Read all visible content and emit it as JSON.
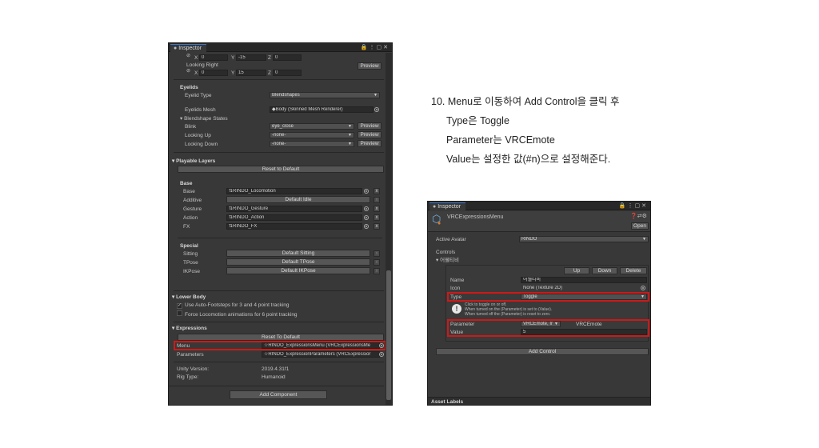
{
  "left_panel": {
    "tab": "Inspector",
    "top": {
      "link_glyph": "⊘",
      "x_label": "X",
      "x1": "0",
      "y_label": "Y",
      "y1": "-15",
      "z_label": "Z",
      "z1": "0",
      "looking_right": "Looking Right",
      "x2": "0",
      "y2": "15",
      "z2": "0",
      "preview": "Preview"
    },
    "eyelids": {
      "header": "Eyelids",
      "eyelid_type_label": "Eyelid Type",
      "eyelid_type_value": "Blendshapes",
      "eyelids_mesh_label": "Eyelids Mesh",
      "eyelids_mesh_value": "Body (Skinned Mesh Renderer)",
      "blendshape_states": "Blendshape States",
      "rows": [
        {
          "label": "Blink",
          "value": "eye_close"
        },
        {
          "label": "Looking Up",
          "value": "-none-"
        },
        {
          "label": "Looking Down",
          "value": "-none-"
        }
      ],
      "preview": "Preview"
    },
    "playable_layers": {
      "header": "Playable Layers",
      "reset": "Reset to Default",
      "base_header": "Base",
      "rows": [
        {
          "label": "Base",
          "value": "RINDO_Locomotion"
        },
        {
          "label": "Additive",
          "value": "Default Idle"
        },
        {
          "label": "Gesture",
          "value": "RINDO_Gesture"
        },
        {
          "label": "Action",
          "value": "RINDO_Action"
        },
        {
          "label": "FX",
          "value": "RINDO_FX"
        }
      ],
      "special_header": "Special",
      "special": [
        {
          "label": "Sitting",
          "value": "Default Sitting"
        },
        {
          "label": "TPose",
          "value": "Default TPose"
        },
        {
          "label": "IKPose",
          "value": "Default IKPose"
        }
      ],
      "x": "x"
    },
    "lower_body": {
      "header": "Lower Body",
      "cb1": "Use Auto-Footsteps for 3 and 4 point tracking",
      "cb1_checked": true,
      "cb2": "Force Locomotion animations for 6 point tracking",
      "cb2_checked": false
    },
    "expressions": {
      "header": "Expressions",
      "reset": "Reset To Default",
      "menu_label": "Menu",
      "menu_value": "RINDO_ExpressionsMenu (VRCExpressionsMe",
      "params_label": "Parameters",
      "params_value": "RINDO_ExpressionParameters (VRCExpressior"
    },
    "unity_version_label": "Unity Version:",
    "unity_version": "2019.4.31f1",
    "rig_type_label": "Rig Type:",
    "rig_type": "Humanoid",
    "add_component": "Add Component"
  },
  "instructions": {
    "line1": "10. Menu로 이동하여 Add Control을 클릭 후",
    "line2": "Type은 Toggle",
    "line3": "Parameter는 VRCEmote",
    "line4": "Value는 설정한 값(#n)으로 설정해준다."
  },
  "right_panel": {
    "tab": "Inspector",
    "asset_name": "VRCExpressionsMenu",
    "open": "Open",
    "active_avatar_label": "Active Avatar",
    "active_avatar_value": "RINDO",
    "controls": "Controls",
    "control_item": "어웰티비",
    "up": "Up",
    "down": "Down",
    "delete": "Delete",
    "name_label": "Name",
    "name_value": "어웰티비",
    "icon_label": "Icon",
    "icon_value": "None (Texture 2D)",
    "type_label": "Type",
    "type_value": "Toggle",
    "help_lines": [
      "Click to toggle on or off.",
      "When turned on the (Parameter) is set to (Value).",
      "When turned off the (Parameter) is reset to zero."
    ],
    "parameter_label": "Parameter",
    "parameter_drop": "VRCEmote, Ir",
    "parameter_value": "VRCEmote",
    "value_label": "Value",
    "value_value": "5",
    "add_control": "Add Control",
    "asset_labels": "Asset Labels"
  },
  "colors": {
    "highlight_red": "#d01818",
    "panel_bg": "#383838",
    "tab_accent": "#3a78c8"
  }
}
